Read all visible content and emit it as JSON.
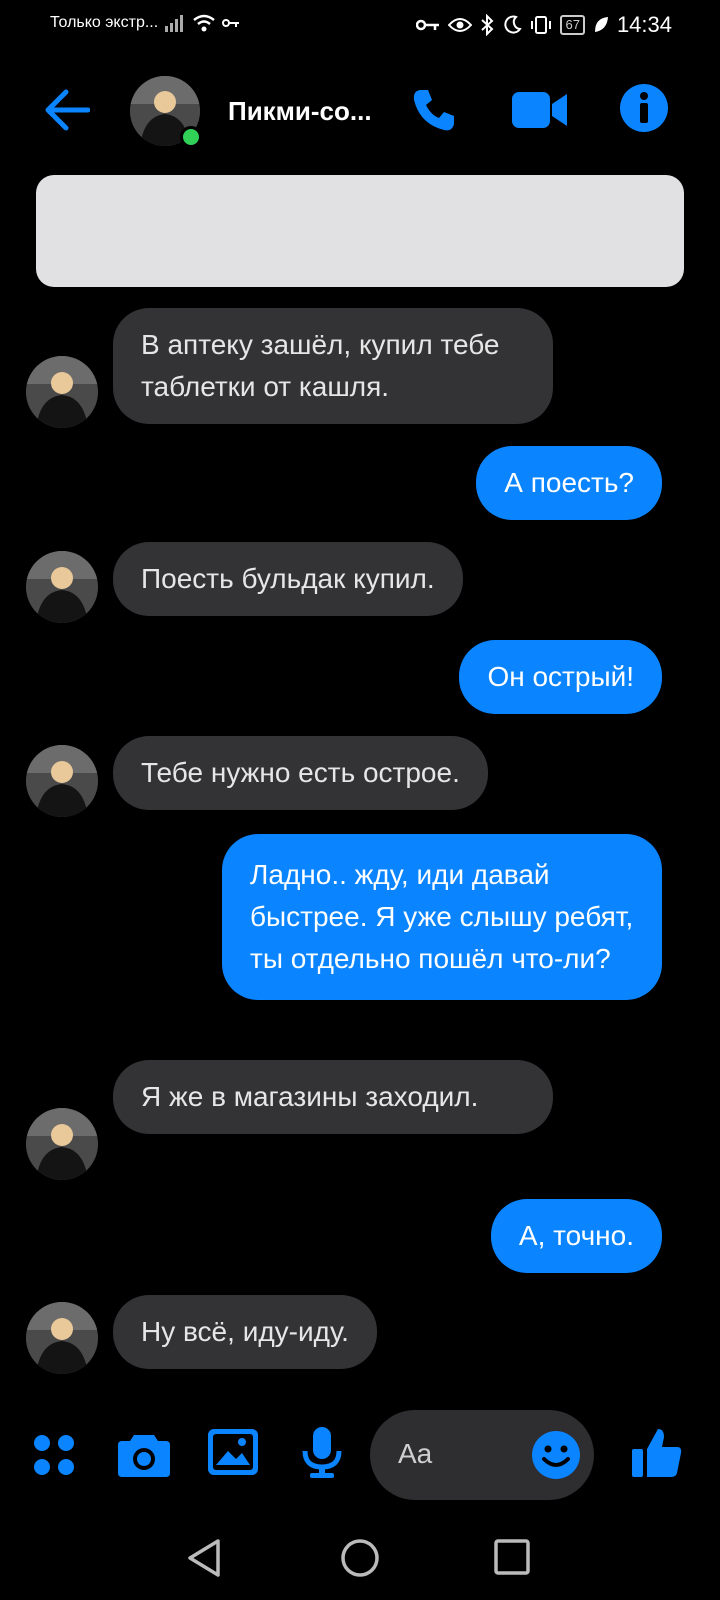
{
  "status_bar": {
    "carrier_text": "Только экстр...",
    "battery": "67",
    "time": "14:34"
  },
  "header": {
    "contact_name": "Пикми-со..."
  },
  "messages": [
    {
      "dir": "in",
      "text": "В аптеку зашёл, купил тебе таблетки от кашля."
    },
    {
      "dir": "out",
      "text": "А поесть?"
    },
    {
      "dir": "in",
      "text": "Поесть бульдак купил."
    },
    {
      "dir": "out",
      "text": "Он острый!"
    },
    {
      "dir": "in",
      "text": "Тебе нужно есть острое."
    },
    {
      "dir": "out",
      "text": "Ладно.. жду, иди давай быстрее. Я уже слышу ребят, ты отдельно пошёл что-ли?"
    },
    {
      "dir": "in",
      "text": "Я же в магазины заходил."
    },
    {
      "dir": "out",
      "text": "А, точно."
    },
    {
      "dir": "in",
      "text": "Ну всё, иду-иду."
    }
  ],
  "composer": {
    "placeholder": "Aa"
  },
  "colors": {
    "accent": "#0a84ff",
    "incoming_bubble": "#333336",
    "online": "#31d158"
  }
}
